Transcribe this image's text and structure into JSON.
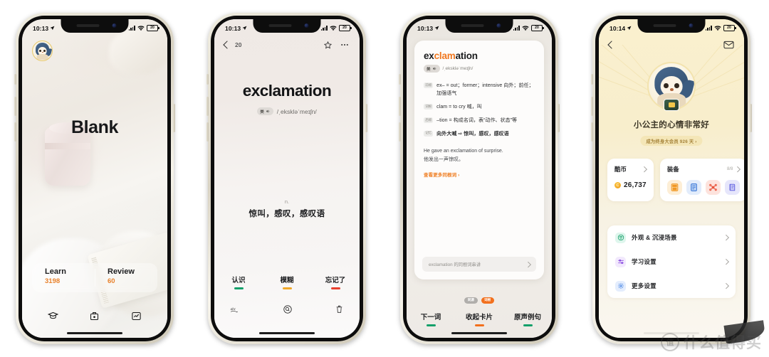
{
  "screens": [
    {
      "id": "home",
      "status": {
        "time": "10:13",
        "battery": "20"
      },
      "avatar_name": "user-avatar",
      "title": "Blank",
      "stats": [
        {
          "label": "Learn",
          "value": "3198"
        },
        {
          "label": "Review",
          "value": "60"
        }
      ],
      "tabs": [
        {
          "name": "graduation-cap-icon"
        },
        {
          "name": "archive-box-icon"
        },
        {
          "name": "chart-trend-icon"
        }
      ]
    },
    {
      "id": "word-card",
      "status": {
        "time": "10:13",
        "battery": "20"
      },
      "nav": {
        "back": "back-arrow",
        "count": "20",
        "star": "star-icon",
        "more": "more-icon"
      },
      "word": "exclamation",
      "accent": "美",
      "phonetic": "/ˌekskləˈmeɪʃn/",
      "pos": "n.",
      "meaning": "惊叫，感叹，感叹语",
      "actions": [
        {
          "label": "认识",
          "color": "#14a06a"
        },
        {
          "label": "模糊",
          "color": "#f0a82a"
        },
        {
          "label": "忘记了",
          "color": "#e8402e"
        }
      ],
      "tabs": [
        {
          "name": "abc-spell-icon"
        },
        {
          "name": "search-icon"
        },
        {
          "name": "trash-icon"
        }
      ]
    },
    {
      "id": "word-detail",
      "status": {
        "time": "10:13",
        "battery": "20"
      },
      "word_prefix": "ex",
      "word_highlight": "clam",
      "word_suffix": "ation",
      "accent": "美",
      "phonetic": "/ˌekskləˈmeɪʃn/",
      "morphemes": [
        {
          "tag": "前缀",
          "text": "ex– = out；former；intensive 向外；前任；加强语气"
        },
        {
          "tag": "词根",
          "text": "clam = to cry  喊，叫"
        },
        {
          "tag": "后缀",
          "text": "–tion = 构成名词，表“动作、状态”等"
        },
        {
          "tag": "记忆",
          "text": "向外大喊  ⇨  惊叫，感叹，感叹语"
        }
      ],
      "example_en": "He gave an exclamation of surprise.",
      "example_cn": "他发出一声惊叹。",
      "more_link": "查看更多同根词 ›",
      "related_card": "exclamation 的同根词串讲",
      "pills": [
        {
          "label": "同源",
          "style": "gray"
        },
        {
          "label": "词根",
          "style": "orange"
        }
      ],
      "actions": [
        {
          "label": "下一词",
          "color": "#14a06a"
        },
        {
          "label": "收起卡片",
          "color": "#f2701d"
        },
        {
          "label": "原声例句",
          "color": "#14a06a"
        }
      ]
    },
    {
      "id": "profile",
      "status": {
        "time": "10:14",
        "battery": "20"
      },
      "nav": {
        "back": "back-arrow",
        "mail": "mail-icon"
      },
      "display_name": "小公主的心情非常好",
      "vip_text": "成为终身大会员 926 天 ›",
      "coin_card": {
        "title": "酷币",
        "value": "26,737"
      },
      "gear_card": {
        "title": "装备",
        "count": "8/8",
        "items": [
          {
            "name": "calculator-gear-icon",
            "bg": "#fdeed6",
            "fg": "#f09520"
          },
          {
            "name": "notebook-gear-icon",
            "bg": "#e2ecfb",
            "fg": "#2b6cd4"
          },
          {
            "name": "network-gear-icon",
            "bg": "#fde3dd",
            "fg": "#e8533a"
          },
          {
            "name": "dictionary-gear-icon",
            "bg": "#e6e6fb",
            "fg": "#5b5be0"
          }
        ]
      },
      "menu": [
        {
          "label": "外观 & 沉浸场景",
          "icon": "palette-icon",
          "bg": "#dff6ed",
          "fg": "#14a06a"
        },
        {
          "label": "学习设置",
          "icon": "sliders-icon",
          "bg": "#f2e9fd",
          "fg": "#8c4fe0"
        },
        {
          "label": "更多设置",
          "icon": "gear-icon",
          "bg": "#e4edfd",
          "fg": "#2b73e0"
        }
      ]
    }
  ],
  "watermark": {
    "mark": "值",
    "text": "什么值得买"
  }
}
